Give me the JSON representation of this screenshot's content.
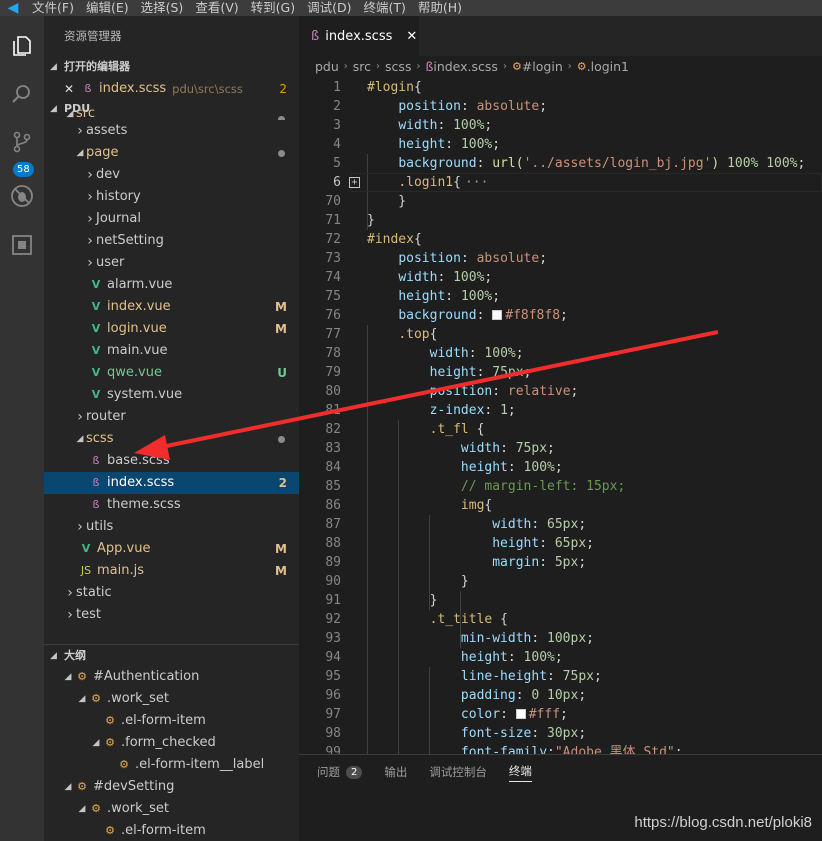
{
  "menu": [
    "文件(F)",
    "编辑(E)",
    "选择(S)",
    "查看(V)",
    "转到(G)",
    "调试(D)",
    "终端(T)",
    "帮助(H)"
  ],
  "activity": {
    "scm_badge": "58"
  },
  "sidebar": {
    "title": "资源管理器",
    "open_editors": {
      "header": "打开的编辑器",
      "item": {
        "name": "index.scss",
        "path": "pdu\\src\\scss",
        "badge": "2"
      }
    },
    "project": "PDU",
    "tree": [
      {
        "label": "src",
        "indent": 1,
        "kind": "folder-open",
        "dot": true,
        "cut": true
      },
      {
        "label": "assets",
        "indent": 2,
        "kind": "folder"
      },
      {
        "label": "page",
        "indent": 2,
        "kind": "folder-open",
        "dot": true
      },
      {
        "label": "dev",
        "indent": 3,
        "kind": "folder"
      },
      {
        "label": "history",
        "indent": 3,
        "kind": "folder"
      },
      {
        "label": "Journal",
        "indent": 3,
        "kind": "folder"
      },
      {
        "label": "netSetting",
        "indent": 3,
        "kind": "folder"
      },
      {
        "label": "user",
        "indent": 3,
        "kind": "folder"
      },
      {
        "label": "alarm.vue",
        "indent": 3,
        "kind": "vue"
      },
      {
        "label": "index.vue",
        "indent": 3,
        "kind": "vue",
        "status": "M"
      },
      {
        "label": "login.vue",
        "indent": 3,
        "kind": "vue",
        "status": "M"
      },
      {
        "label": "main.vue",
        "indent": 3,
        "kind": "vue"
      },
      {
        "label": "qwe.vue",
        "indent": 3,
        "kind": "vue",
        "status": "U"
      },
      {
        "label": "system.vue",
        "indent": 3,
        "kind": "vue"
      },
      {
        "label": "router",
        "indent": 2,
        "kind": "folder"
      },
      {
        "label": "scss",
        "indent": 2,
        "kind": "folder-open",
        "dot": true
      },
      {
        "label": "base.scss",
        "indent": 3,
        "kind": "scss"
      },
      {
        "label": "index.scss",
        "indent": 3,
        "kind": "scss",
        "status": "2",
        "selected": true
      },
      {
        "label": "theme.scss",
        "indent": 3,
        "kind": "scss"
      },
      {
        "label": "utils",
        "indent": 2,
        "kind": "folder"
      },
      {
        "label": "App.vue",
        "indent": 2,
        "kind": "vue",
        "status": "M"
      },
      {
        "label": "main.js",
        "indent": 2,
        "kind": "js",
        "status": "M"
      },
      {
        "label": "static",
        "indent": 1,
        "kind": "folder"
      },
      {
        "label": "test",
        "indent": 1,
        "kind": "folder"
      }
    ],
    "outline_header": "大纲",
    "outline": [
      {
        "label": "#Authentication",
        "indent": 1,
        "open": true
      },
      {
        "label": ".work_set",
        "indent": 2,
        "open": true
      },
      {
        "label": ".el-form-item",
        "indent": 3
      },
      {
        "label": ".form_checked",
        "indent": 3,
        "open": true
      },
      {
        "label": ".el-form-item__label",
        "indent": 4
      },
      {
        "label": "#devSetting",
        "indent": 1,
        "open": true
      },
      {
        "label": ".work_set",
        "indent": 2,
        "open": true
      },
      {
        "label": ".el-form-item",
        "indent": 3
      }
    ]
  },
  "editor": {
    "tab_label": "index.scss",
    "breadcrumbs": [
      "pdu",
      "src",
      "scss",
      "index.scss",
      "#login",
      ".login1"
    ],
    "lines": [
      {
        "n": "1",
        "t": [
          [
            "sel-c",
            "#login"
          ],
          [
            "pn",
            "{"
          ]
        ]
      },
      {
        "n": "2",
        "t": [
          [
            "pn",
            "    "
          ],
          [
            "prop",
            "position"
          ],
          [
            "pn",
            ": "
          ],
          [
            "val",
            "absolute"
          ],
          [
            "pn",
            ";"
          ]
        ]
      },
      {
        "n": "3",
        "t": [
          [
            "pn",
            "    "
          ],
          [
            "prop",
            "width"
          ],
          [
            "pn",
            ": "
          ],
          [
            "num-c",
            "100%"
          ],
          [
            "pn",
            ";"
          ]
        ]
      },
      {
        "n": "4",
        "t": [
          [
            "pn",
            "    "
          ],
          [
            "prop",
            "height"
          ],
          [
            "pn",
            ": "
          ],
          [
            "num-c",
            "100%"
          ],
          [
            "pn",
            ";"
          ]
        ]
      },
      {
        "n": "5",
        "t": [
          [
            "pn",
            "    "
          ],
          [
            "prop",
            "background"
          ],
          [
            "pn",
            ": "
          ],
          [
            "fn",
            "url("
          ],
          [
            "val",
            "'../assets/login_bj.jpg'"
          ],
          [
            "fn",
            ")"
          ],
          [
            "pn",
            " "
          ],
          [
            "num-c",
            "100%"
          ],
          [
            "pn",
            " "
          ],
          [
            "num-c",
            "100%"
          ],
          [
            "pn",
            ";"
          ]
        ]
      },
      {
        "n": "6",
        "t": [
          [
            "pn",
            "    "
          ],
          [
            "sel-c",
            ".login1"
          ],
          [
            "pn",
            "{"
          ],
          [
            "pn",
            "···"
          ]
        ],
        "cur": true,
        "fold": true
      },
      {
        "n": "70",
        "t": [
          [
            "pn",
            "    }"
          ]
        ]
      },
      {
        "n": "71",
        "t": [
          [
            "pn",
            "}"
          ]
        ]
      },
      {
        "n": "72",
        "t": [
          [
            "sel-c",
            "#index"
          ],
          [
            "pn",
            "{"
          ]
        ]
      },
      {
        "n": "73",
        "t": [
          [
            "pn",
            "    "
          ],
          [
            "prop",
            "position"
          ],
          [
            "pn",
            ": "
          ],
          [
            "val",
            "absolute"
          ],
          [
            "pn",
            ";"
          ]
        ]
      },
      {
        "n": "74",
        "t": [
          [
            "pn",
            "    "
          ],
          [
            "prop",
            "width"
          ],
          [
            "pn",
            ": "
          ],
          [
            "num-c",
            "100%"
          ],
          [
            "pn",
            ";"
          ]
        ]
      },
      {
        "n": "75",
        "t": [
          [
            "pn",
            "    "
          ],
          [
            "prop",
            "height"
          ],
          [
            "pn",
            ": "
          ],
          [
            "num-c",
            "100%"
          ],
          [
            "pn",
            ";"
          ]
        ]
      },
      {
        "n": "76",
        "t": [
          [
            "pn",
            "    "
          ],
          [
            "prop",
            "background"
          ],
          [
            "pn",
            ": "
          ],
          [
            "swatch",
            "#f8f8f8"
          ],
          [
            "val",
            "#f8f8f8"
          ],
          [
            "pn",
            ";"
          ]
        ]
      },
      {
        "n": "77",
        "t": [
          [
            "pn",
            "    "
          ],
          [
            "sel-c",
            ".top"
          ],
          [
            "pn",
            "{"
          ]
        ]
      },
      {
        "n": "78",
        "t": [
          [
            "pn",
            "        "
          ],
          [
            "prop",
            "width"
          ],
          [
            "pn",
            ": "
          ],
          [
            "num-c",
            "100%"
          ],
          [
            "pn",
            ";"
          ]
        ]
      },
      {
        "n": "79",
        "t": [
          [
            "pn",
            "        "
          ],
          [
            "prop",
            "height"
          ],
          [
            "pn",
            ": "
          ],
          [
            "num-c",
            "75px"
          ],
          [
            "pn",
            ";"
          ]
        ]
      },
      {
        "n": "80",
        "t": [
          [
            "pn",
            "        "
          ],
          [
            "prop",
            "position"
          ],
          [
            "pn",
            ": "
          ],
          [
            "val",
            "relative"
          ],
          [
            "pn",
            ";"
          ]
        ]
      },
      {
        "n": "81",
        "t": [
          [
            "pn",
            "        "
          ],
          [
            "prop",
            "z-index"
          ],
          [
            "pn",
            ": "
          ],
          [
            "num-c",
            "1"
          ],
          [
            "pn",
            ";"
          ]
        ]
      },
      {
        "n": "82",
        "t": [
          [
            "pn",
            "        "
          ],
          [
            "sel-c",
            ".t_fl"
          ],
          [
            "pn",
            " {"
          ]
        ]
      },
      {
        "n": "83",
        "t": [
          [
            "pn",
            "            "
          ],
          [
            "prop",
            "width"
          ],
          [
            "pn",
            ": "
          ],
          [
            "num-c",
            "75px"
          ],
          [
            "pn",
            ";"
          ]
        ]
      },
      {
        "n": "84",
        "t": [
          [
            "pn",
            "            "
          ],
          [
            "prop",
            "height"
          ],
          [
            "pn",
            ": "
          ],
          [
            "num-c",
            "100%"
          ],
          [
            "pn",
            ";"
          ]
        ]
      },
      {
        "n": "85",
        "t": [
          [
            "pn",
            "            "
          ],
          [
            "cm",
            "// margin-left: 15px;"
          ]
        ]
      },
      {
        "n": "86",
        "t": [
          [
            "pn",
            "            "
          ],
          [
            "sel-c",
            "img"
          ],
          [
            "pn",
            "{"
          ]
        ]
      },
      {
        "n": "87",
        "t": [
          [
            "pn",
            "                "
          ],
          [
            "prop",
            "width"
          ],
          [
            "pn",
            ": "
          ],
          [
            "num-c",
            "65px"
          ],
          [
            "pn",
            ";"
          ]
        ]
      },
      {
        "n": "88",
        "t": [
          [
            "pn",
            "                "
          ],
          [
            "prop",
            "height"
          ],
          [
            "pn",
            ": "
          ],
          [
            "num-c",
            "65px"
          ],
          [
            "pn",
            ";"
          ]
        ]
      },
      {
        "n": "89",
        "t": [
          [
            "pn",
            "                "
          ],
          [
            "prop",
            "margin"
          ],
          [
            "pn",
            ": "
          ],
          [
            "num-c",
            "5px"
          ],
          [
            "pn",
            ";"
          ]
        ]
      },
      {
        "n": "90",
        "t": [
          [
            "pn",
            "            }"
          ]
        ]
      },
      {
        "n": "91",
        "t": [
          [
            "pn",
            "        }"
          ]
        ]
      },
      {
        "n": "92",
        "t": [
          [
            "pn",
            "        "
          ],
          [
            "sel-c",
            ".t_title"
          ],
          [
            "pn",
            " {"
          ]
        ]
      },
      {
        "n": "93",
        "t": [
          [
            "pn",
            "            "
          ],
          [
            "prop",
            "min-width"
          ],
          [
            "pn",
            ": "
          ],
          [
            "num-c",
            "100px"
          ],
          [
            "pn",
            ";"
          ]
        ]
      },
      {
        "n": "94",
        "t": [
          [
            "pn",
            "            "
          ],
          [
            "prop",
            "height"
          ],
          [
            "pn",
            ": "
          ],
          [
            "num-c",
            "100%"
          ],
          [
            "pn",
            ";"
          ]
        ]
      },
      {
        "n": "95",
        "t": [
          [
            "pn",
            "            "
          ],
          [
            "prop",
            "line-height"
          ],
          [
            "pn",
            ": "
          ],
          [
            "num-c",
            "75px"
          ],
          [
            "pn",
            ";"
          ]
        ]
      },
      {
        "n": "96",
        "t": [
          [
            "pn",
            "            "
          ],
          [
            "prop",
            "padding"
          ],
          [
            "pn",
            ": "
          ],
          [
            "num-c",
            "0 10px"
          ],
          [
            "pn",
            ";"
          ]
        ]
      },
      {
        "n": "97",
        "t": [
          [
            "pn",
            "            "
          ],
          [
            "prop",
            "color"
          ],
          [
            "pn",
            ": "
          ],
          [
            "swatch",
            "#fff"
          ],
          [
            "val",
            "#fff"
          ],
          [
            "pn",
            ";"
          ]
        ]
      },
      {
        "n": "98",
        "t": [
          [
            "pn",
            "            "
          ],
          [
            "prop",
            "font-size"
          ],
          [
            "pn",
            ": "
          ],
          [
            "num-c",
            "30px"
          ],
          [
            "pn",
            ";"
          ]
        ]
      },
      {
        "n": "99",
        "t": [
          [
            "pn",
            "            "
          ],
          [
            "prop",
            "font-family"
          ],
          [
            "pn",
            ":"
          ],
          [
            "val",
            "\"Adobe 黑体 Std\""
          ],
          [
            "pn",
            ";"
          ]
        ]
      }
    ]
  },
  "panel": {
    "tabs": [
      {
        "label": "问题",
        "badge": "2"
      },
      {
        "label": "输出"
      },
      {
        "label": "调试控制台"
      },
      {
        "label": "终端",
        "active": true
      }
    ]
  },
  "watermark": "https://blog.csdn.net/ploki8",
  "colors": {
    "accent": "#007acc",
    "annotation_arrow": "#f02c2c"
  }
}
